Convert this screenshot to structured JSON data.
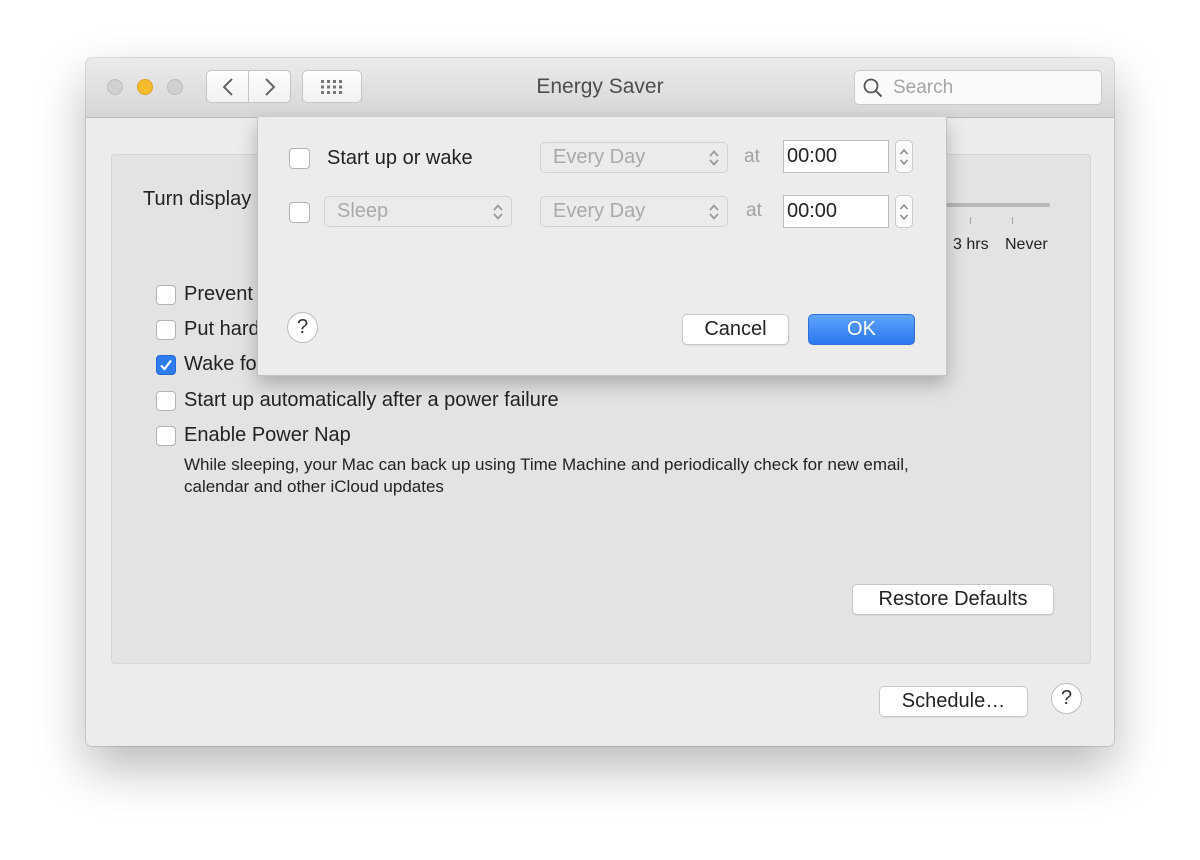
{
  "window": {
    "title": "Energy Saver",
    "search_placeholder": "Search"
  },
  "panel": {
    "turn_display_label": "Turn display",
    "slider_ticks": [
      "3 hrs",
      "Never"
    ],
    "options": [
      {
        "label": "Prevent",
        "checked": false
      },
      {
        "label": "Put hard",
        "checked": false
      },
      {
        "label": "Wake fo",
        "checked": true
      },
      {
        "label": "Start up automatically after a power failure",
        "checked": false
      },
      {
        "label": "Enable Power Nap",
        "checked": false
      }
    ],
    "power_nap_description_line1": "While sleeping, your Mac can back up using Time Machine and periodically check for new email,",
    "power_nap_description_line2": "calendar and other iCloud updates",
    "restore_defaults_label": "Restore Defaults"
  },
  "footer": {
    "schedule_label": "Schedule…",
    "help_label": "?"
  },
  "schedule_sheet": {
    "rows": [
      {
        "checked": false,
        "action": "Start up or wake",
        "days": "Every Day",
        "at_label": "at",
        "time": "00:00"
      },
      {
        "checked": false,
        "action": "Sleep",
        "days": "Every Day",
        "at_label": "at",
        "time": "00:00"
      }
    ],
    "help_label": "?",
    "cancel_label": "Cancel",
    "ok_label": "OK"
  },
  "colors": {
    "accent": "#2c77f0",
    "minimize_light": "#f5bd2e"
  }
}
